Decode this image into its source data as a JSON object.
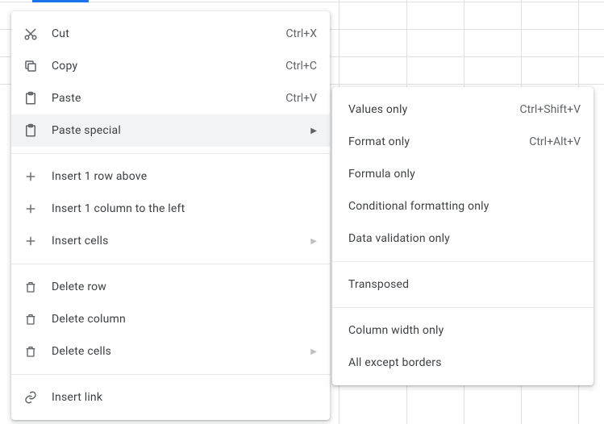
{
  "context_menu": {
    "cut": {
      "label": "Cut",
      "shortcut": "Ctrl+X"
    },
    "copy": {
      "label": "Copy",
      "shortcut": "Ctrl+C"
    },
    "paste": {
      "label": "Paste",
      "shortcut": "Ctrl+V"
    },
    "paste_special": {
      "label": "Paste special"
    },
    "insert_row_above": {
      "label": "Insert 1 row above"
    },
    "insert_column_left": {
      "label": "Insert 1 column to the left"
    },
    "insert_cells": {
      "label": "Insert cells"
    },
    "delete_row": {
      "label": "Delete row"
    },
    "delete_column": {
      "label": "Delete column"
    },
    "delete_cells": {
      "label": "Delete cells"
    },
    "insert_link": {
      "label": "Insert link"
    }
  },
  "paste_special_submenu": {
    "values_only": {
      "label": "Values only",
      "shortcut": "Ctrl+Shift+V"
    },
    "format_only": {
      "label": "Format only",
      "shortcut": "Ctrl+Alt+V"
    },
    "formula_only": {
      "label": "Formula only"
    },
    "conditional_formatting_only": {
      "label": "Conditional formatting only"
    },
    "data_validation_only": {
      "label": "Data validation only"
    },
    "transposed": {
      "label": "Transposed"
    },
    "column_width_only": {
      "label": "Column width only"
    },
    "all_except_borders": {
      "label": "All except borders"
    }
  }
}
